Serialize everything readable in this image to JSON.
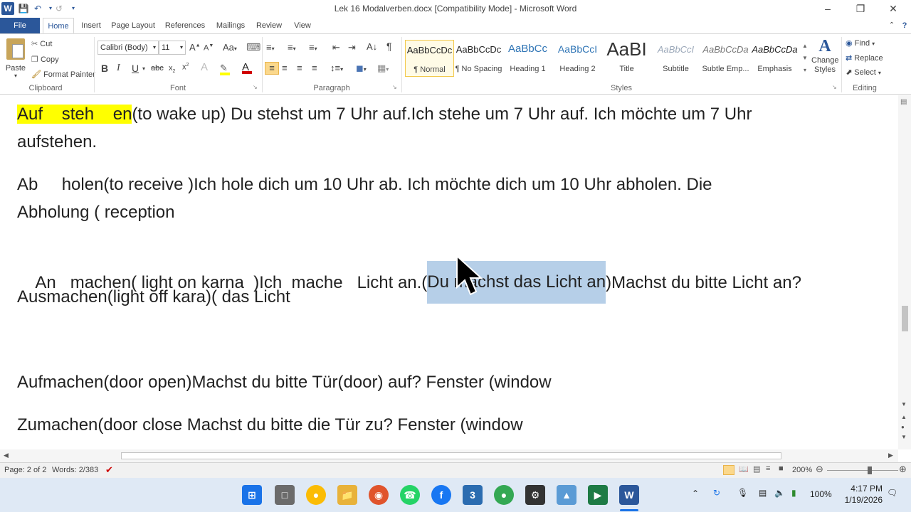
{
  "titlebar": {
    "title": "Lek 16 Modalverben.docx [Compatibility Mode] - Microsoft Word",
    "app_icon": "W"
  },
  "tabs": [
    "File",
    "Home",
    "Insert",
    "Page Layout",
    "References",
    "Mailings",
    "Review",
    "View"
  ],
  "active_tab": "Home",
  "clipboard": {
    "paste": "Paste",
    "cut": "Cut",
    "copy": "Copy",
    "format_painter": "Format Painter",
    "label": "Clipboard"
  },
  "font": {
    "family": "Calibri (Body)",
    "size": "11",
    "label": "Font"
  },
  "paragraph": {
    "label": "Paragraph"
  },
  "styles": {
    "label": "Styles",
    "items": [
      {
        "preview": "AaBbCcDc",
        "name": "¶ Normal"
      },
      {
        "preview": "AaBbCcDc",
        "name": "¶ No Spacing"
      },
      {
        "preview": "AaBbCc",
        "name": "Heading 1"
      },
      {
        "preview": "AaBbCcI",
        "name": "Heading 2"
      },
      {
        "preview": "AaBI",
        "name": "Title"
      },
      {
        "preview": "AaBbCcI",
        "name": "Subtitle"
      },
      {
        "preview": "AaBbCcDa",
        "name": "Subtle Emp..."
      },
      {
        "preview": "AaBbCcDa",
        "name": "Emphasis"
      }
    ],
    "change_styles": "Change Styles"
  },
  "editing": {
    "find": "Find",
    "replace": "Replace",
    "select": "Select",
    "label": "Editing"
  },
  "document": {
    "p1_hl": "Auf    steh    en",
    "p1_rest": "(to wake up) Du stehst um 7 Uhr auf.Ich stehe um 7 Uhr auf. Ich möchte um 7 Uhr",
    "p1_line2": "aufstehen.",
    "p2_line1": "Ab     holen(to receive )Ich hole dich um 10 Uhr ab. Ich möchte dich um 10 Uhr abholen. Die",
    "p2_line2": "Abholung ( reception",
    "p3_before": "An   machen( light on karna  )Ich  mache   Licht an.(",
    "p3_selected": "Du machst das Licht an",
    "p3_after": ")Machst du bitte Licht an?",
    "p4": "Ausmachen(light off kara)( das Licht",
    "p5": "Aufmachen(door open)Machst du bitte  Tür(door) auf? Fenster (window",
    "p6": "Zumachen(door close Machst du bitte die Tür zu? Fenster (window"
  },
  "statusbar": {
    "page": "Page: 2 of 2",
    "words": "Words: 2/383",
    "zoom": "200%"
  },
  "taskbar": {
    "time": "4:17 PM",
    "date": "1/19/2026",
    "battery": "100%"
  }
}
